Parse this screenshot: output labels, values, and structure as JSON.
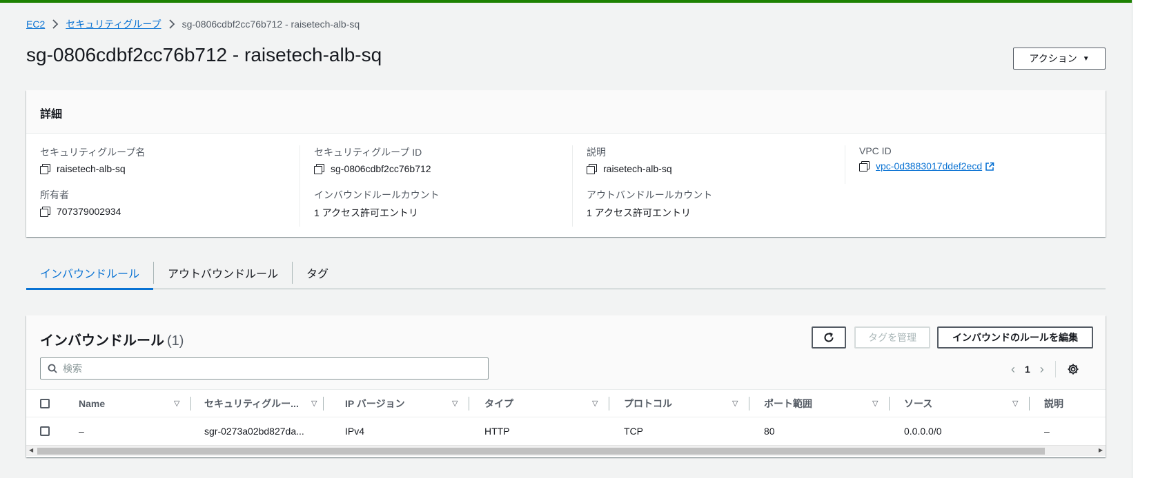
{
  "colors": {
    "accent": "#0972d3",
    "topbar": "#1d8102",
    "text": "#16191f",
    "muted": "#545b64"
  },
  "breadcrumb": {
    "items": [
      "EC2",
      "セキュリティグループ"
    ],
    "current": "sg-0806cdbf2cc76b712 - raisetech-alb-sq"
  },
  "page": {
    "title": "sg-0806cdbf2cc76b712 - raisetech-alb-sq",
    "actions_label": "アクション"
  },
  "details": {
    "header": "詳細",
    "sg_name": {
      "label": "セキュリティグループ名",
      "value": "raisetech-alb-sq"
    },
    "sg_id": {
      "label": "セキュリティグループ ID",
      "value": "sg-0806cdbf2cc76b712"
    },
    "description": {
      "label": "説明",
      "value": "raisetech-alb-sq"
    },
    "vpc_id": {
      "label": "VPC ID",
      "value": "vpc-0d3883017ddef2ecd"
    },
    "owner": {
      "label": "所有者",
      "value": "707379002934"
    },
    "inbound_count": {
      "label": "インバウンドルールカウント",
      "value": "1 アクセス許可エントリ"
    },
    "outbound_count": {
      "label": "アウトバンドルールカウント",
      "value": "1 アクセス許可エントリ"
    }
  },
  "tabs": [
    {
      "label": "インバウンドルール",
      "active": true
    },
    {
      "label": "アウトバウンドルール",
      "active": false
    },
    {
      "label": "タグ",
      "active": false
    }
  ],
  "rules": {
    "title": "インバウンドルール",
    "count": "(1)",
    "manage_tags_label": "タグを管理",
    "edit_label": "インバウンドのルールを編集",
    "search_placeholder": "検索",
    "page_number": "1",
    "columns": [
      "Name",
      "セキュリティグルー...",
      "IP バージョン",
      "タイプ",
      "プロトコル",
      "ポート範囲",
      "ソース",
      "説明"
    ],
    "rows": [
      {
        "name": "–",
        "sg_rule_id": "sgr-0273a02bd827da...",
        "ip_version": "IPv4",
        "type": "HTTP",
        "protocol": "TCP",
        "port_range": "80",
        "source": "0.0.0.0/0",
        "description": "–"
      }
    ]
  }
}
